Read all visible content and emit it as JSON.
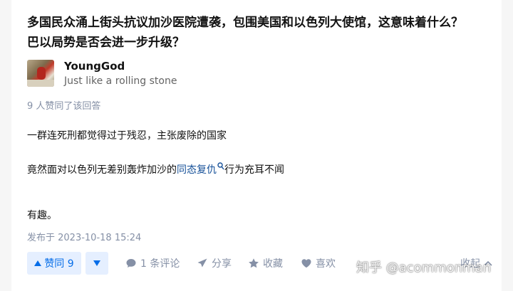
{
  "question": {
    "title_line1": "多国民众涌上街头抗议加沙医院遭袭，包围美国和以色列大使馆，这意味着什么？",
    "title_line2": "巴以局势是否会进一步升级？"
  },
  "author": {
    "name": "YoungGod",
    "bio": "Just like a rolling stone"
  },
  "votes_text": "9 人赞同了该回答",
  "answer": {
    "paragraph1": "一群连死刑都觉得过于残忍，主张废除的国家",
    "paragraph2_before": "竟然面对以色列无差别轰炸加沙的",
    "paragraph2_link": "同态复仇",
    "paragraph2_after": "行为充耳不闻",
    "paragraph3": "有趣。"
  },
  "meta": {
    "published": "发布于 2023-10-18 15:24"
  },
  "actions": {
    "upvote_label": "赞同 9",
    "comment_label": "1 条评论",
    "share_label": "分享",
    "favorite_label": "收藏",
    "like_label": "喜欢",
    "collapse_label": "收起"
  },
  "watermark": "知乎 @acommonman",
  "colors": {
    "primary": "#056de8",
    "primary_bg": "#e5efff",
    "link": "#175199",
    "muted": "#8590a6"
  }
}
